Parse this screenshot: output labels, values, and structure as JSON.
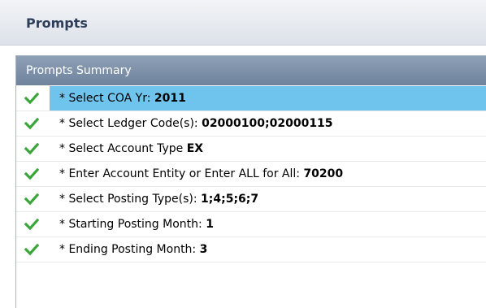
{
  "prompts_header": {
    "title": "Prompts"
  },
  "summary": {
    "title": "Prompts Summary",
    "items": [
      {
        "label": "* Select COA Yr: ",
        "value": "2011",
        "selected": true
      },
      {
        "label": "* Select Ledger Code(s): ",
        "value": "02000100;02000115",
        "selected": false
      },
      {
        "label": "* Select Account Type ",
        "value": "EX",
        "selected": false
      },
      {
        "label": "* Enter Account Entity or Enter ALL for All: ",
        "value": "70200",
        "selected": false
      },
      {
        "label": "* Select Posting Type(s): ",
        "value": "1;4;5;6;7",
        "selected": false
      },
      {
        "label": "* Starting Posting Month: ",
        "value": "1",
        "selected": false
      },
      {
        "label": "* Ending Posting Month: ",
        "value": "3",
        "selected": false
      }
    ],
    "check_icon": "checkmark-icon",
    "check_color": "#3aa63a",
    "selected_color": "#6ec4ec"
  }
}
